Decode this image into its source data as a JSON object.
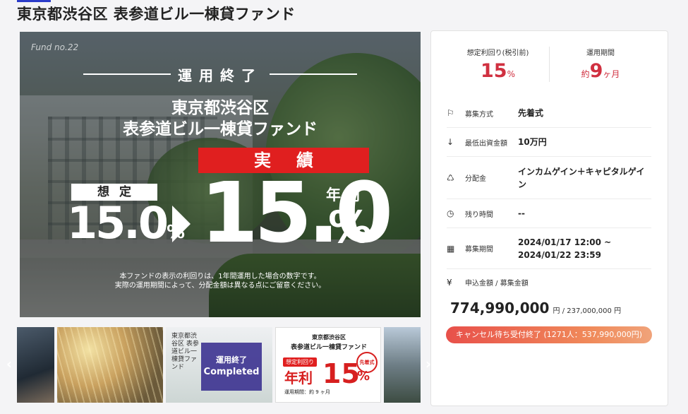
{
  "page": {
    "title": "東京都渋谷区 表参道ビル一棟貸ファンド"
  },
  "hero": {
    "fund_no": "Fund no.22",
    "status": "運用終了",
    "fund_name_line1": "東京都渋谷区",
    "fund_name_line2": "表参道ビル一棟貸ファンド",
    "actual_label": "実績",
    "expected_label": "想定",
    "expected_rate": "15.0",
    "actual_rate": "15.0",
    "percent": "%",
    "annual_label": "年利",
    "note_line1": "本ファンドの表示の利回りは、1年間運用した場合の数字です。",
    "note_line2": "実際の運用期間によって、分配金額は異なる点にご留意ください。"
  },
  "thumbnails": {
    "completed_jp": "運用終了",
    "completed_en": "Completed",
    "thumb_c_title": "東京都渋谷区 表参道ビル一棟貸ファンド",
    "thumb_d_title1": "東京都渋谷区",
    "thumb_d_title2": "表参道ビル一棟貸ファンド",
    "thumb_d_tag": "想定利回り",
    "thumb_d_nenri": "年利",
    "thumb_d_rate": "15",
    "thumb_d_pct": "%",
    "thumb_d_badge": "先着式",
    "thumb_d_period": "運用期間：約 9 ヶ月"
  },
  "summary": {
    "yield_label": "想定利回り(税引前)",
    "yield_value": "15",
    "yield_unit": "%",
    "period_label": "運用期間",
    "period_prefix": "約",
    "period_value": "9",
    "period_unit": "ヶ月"
  },
  "details": [
    {
      "icon": "flag-icon",
      "glyph": "⚐",
      "label": "募集方式",
      "value": "先着式"
    },
    {
      "icon": "arrow-down-icon",
      "glyph": "↓",
      "label": "最低出資金額",
      "value": "10万円"
    },
    {
      "icon": "piggy-bank-icon",
      "glyph": "♺",
      "label": "分配金",
      "value": "インカムゲイン＋キャピタルゲイン"
    },
    {
      "icon": "clock-icon",
      "glyph": "◷",
      "label": "残り時間",
      "value": "--"
    },
    {
      "icon": "calendar-icon",
      "glyph": "▦",
      "label": "募集期間",
      "value_line1": "2024/01/17 12:00 ~",
      "value_line2": "2024/01/22 23:59"
    }
  ],
  "amount": {
    "icon": "yen-icon",
    "glyph": "¥",
    "label": "申込金額 / 募集金額",
    "applied": "774,990,000",
    "applied_unit": "円",
    "target": " / 237,000,000 円"
  },
  "cancel_button": {
    "label": "キャンセル待ち受付終了 (1271人：537,990,000円)"
  },
  "colors": {
    "accent_red": "#d03040",
    "brand_blue": "#2b3cc9"
  }
}
